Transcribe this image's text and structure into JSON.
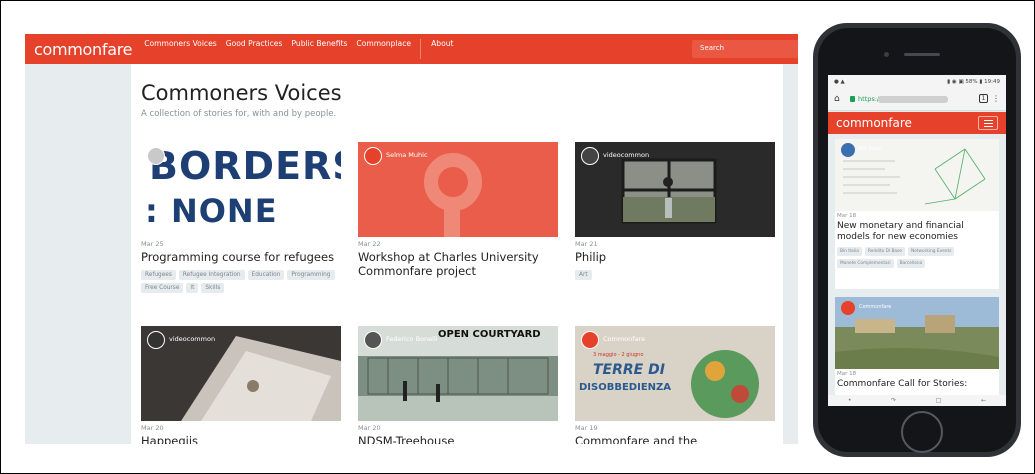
{
  "desktop": {
    "logo": "commonfare",
    "nav": [
      "Commoners Voices",
      "Good Practices",
      "Public Benefits",
      "Commonplace",
      "About"
    ],
    "search_placeholder": "Search",
    "page_title": "Commoners Voices",
    "page_subtitle": "A collection of stories for, with and by people.",
    "cards": [
      {
        "user": "",
        "date": "Mar 25",
        "title": "Programming course for refugees",
        "image_text_1": "BORDERS",
        "image_text_2": ": NONE",
        "tags": [
          "Refugees",
          "Refugee Integration",
          "Education",
          "Programming",
          "Free Course",
          "It",
          "Skills"
        ]
      },
      {
        "user": "Selma Muhic",
        "date": "Mar 22",
        "title": "Workshop at Charles University Commonfare project",
        "tags": []
      },
      {
        "user": "videocommon",
        "date": "Mar 21",
        "title": "Philip",
        "tags": [
          "Art"
        ]
      },
      {
        "user": "videocommon",
        "date": "Mar 20",
        "title": "Happegiis",
        "tags": []
      },
      {
        "user": "Federico Bonelli",
        "date": "Mar 20",
        "title": "NDSM-Treehouse",
        "image_text_1": "OPEN COURTYARD",
        "tags": []
      },
      {
        "user": "Commonfare",
        "date": "Mar 19",
        "title": "Commonfare and the",
        "image_text_1": "TERRE DI",
        "image_text_2": "DISOBBEDIENZA",
        "image_text_3": "3 maggio - 2 giugno",
        "tags": []
      }
    ]
  },
  "phone": {
    "status_left": "● ▲",
    "status_right": "▮ ◉ ▣ 58% ▮ 19:49",
    "url": "https://",
    "tabs_count": "1",
    "logo": "commonfare",
    "cards": [
      {
        "user": "Bin Italia",
        "date": "Mar 18",
        "title": "New monetary and financial models for new economies",
        "tags": [
          "Bin Italia",
          "Reddito Di Base",
          "Networking Events",
          "Monete Complementari",
          "Barcellona"
        ]
      },
      {
        "user": "Commonfare",
        "date": "Mar 18",
        "title": "Commonfare Call for Stories:",
        "tags": []
      }
    ]
  }
}
